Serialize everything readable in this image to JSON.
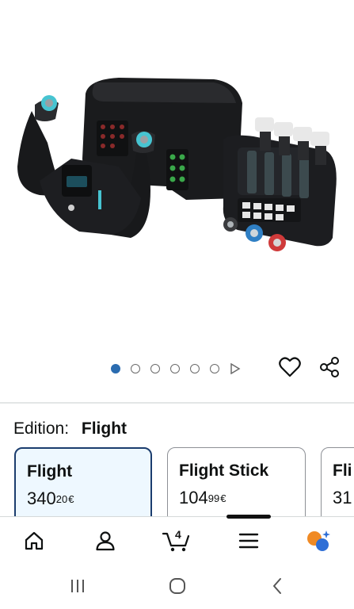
{
  "product": {
    "image_icon": "flight-yoke-throttle-image"
  },
  "carousel": {
    "dot_count": 6,
    "active_index": 0,
    "video_indicator": "play-icon"
  },
  "actions": {
    "favorite_icon": "heart-icon",
    "share_icon": "share-icon"
  },
  "edition": {
    "label": "Edition:",
    "value": "Flight"
  },
  "options": [
    {
      "name": "Flight",
      "price_whole": "340",
      "price_fraction": "20",
      "currency": "€",
      "selected": true
    },
    {
      "name": "Flight Stick",
      "price_whole": "104",
      "price_fraction": "99",
      "currency": "€",
      "selected": false
    },
    {
      "name": "Fli",
      "price_whole": "31",
      "price_fraction": "",
      "currency": "",
      "selected": false
    }
  ],
  "bottom_nav": {
    "items": [
      "home-icon",
      "account-icon",
      "cart-icon",
      "menu-icon",
      "assistant-icon"
    ],
    "cart_count": "4",
    "active_item": "menu-icon"
  },
  "system_nav": {
    "items": [
      "recents-icon",
      "home-circle-icon",
      "back-icon"
    ]
  },
  "colors": {
    "selected_border": "#1b3d6e",
    "selected_bg": "#eef8ff",
    "active_dot": "#2b6cb0"
  }
}
